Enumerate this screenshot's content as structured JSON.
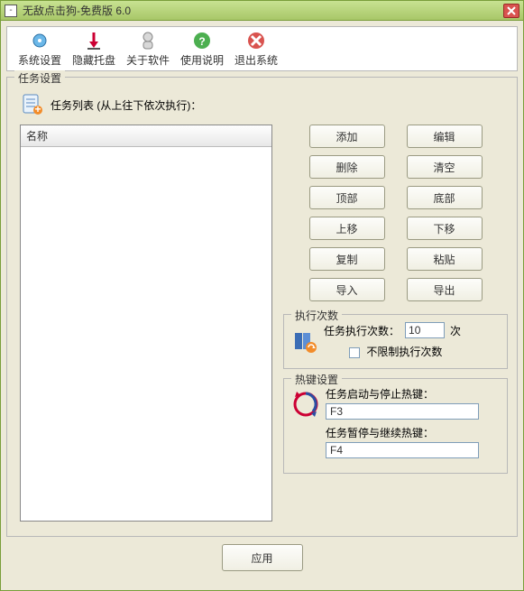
{
  "window": {
    "title": "无敌点击狗-免费版 6.0"
  },
  "toolbar": {
    "items": [
      {
        "label": "系统设置"
      },
      {
        "label": "隐藏托盘"
      },
      {
        "label": "关于软件"
      },
      {
        "label": "使用说明"
      },
      {
        "label": "退出系统"
      }
    ]
  },
  "task_group": {
    "legend": "任务设置",
    "header": "任务列表 (从上往下依次执行)：",
    "column": "名称"
  },
  "buttons": {
    "add": "添加",
    "edit": "编辑",
    "delete": "删除",
    "clear": "清空",
    "top": "顶部",
    "bottom": "底部",
    "up": "上移",
    "down": "下移",
    "copy": "复制",
    "paste": "粘贴",
    "import": "导入",
    "export": "导出"
  },
  "exec": {
    "legend": "执行次数",
    "label": "任务执行次数：",
    "value": "10",
    "suffix": "次",
    "unlimited_label": "不限制执行次数"
  },
  "hotkey": {
    "legend": "热键设置",
    "start_stop_label": "任务启动与停止热键：",
    "start_stop_value": "F3",
    "pause_resume_label": "任务暂停与继续热键：",
    "pause_resume_value": "F4"
  },
  "footer": {
    "apply": "应用"
  }
}
